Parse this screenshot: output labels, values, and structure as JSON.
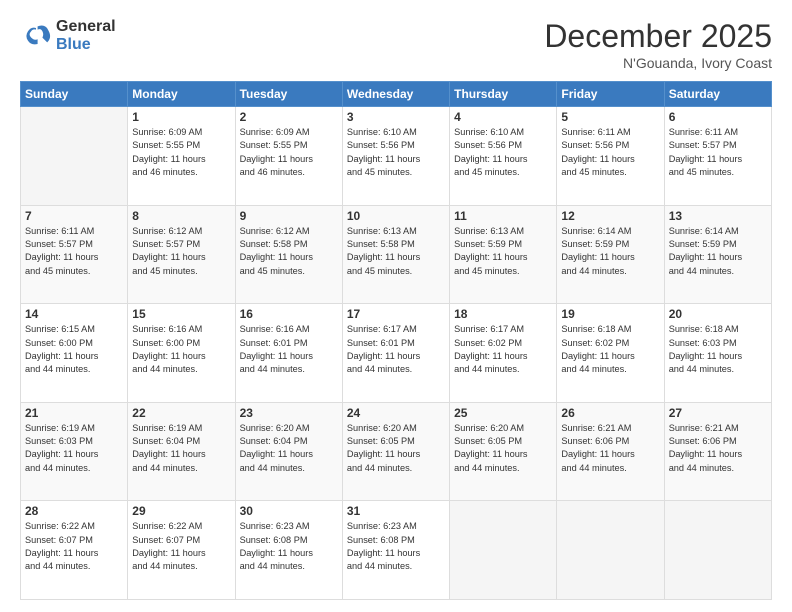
{
  "logo": {
    "general": "General",
    "blue": "Blue"
  },
  "title": "December 2025",
  "location": "N'Gouanda, Ivory Coast",
  "days_header": [
    "Sunday",
    "Monday",
    "Tuesday",
    "Wednesday",
    "Thursday",
    "Friday",
    "Saturday"
  ],
  "weeks": [
    [
      {
        "day": "",
        "info": ""
      },
      {
        "day": "1",
        "info": "Sunrise: 6:09 AM\nSunset: 5:55 PM\nDaylight: 11 hours\nand 46 minutes."
      },
      {
        "day": "2",
        "info": "Sunrise: 6:09 AM\nSunset: 5:55 PM\nDaylight: 11 hours\nand 46 minutes."
      },
      {
        "day": "3",
        "info": "Sunrise: 6:10 AM\nSunset: 5:56 PM\nDaylight: 11 hours\nand 45 minutes."
      },
      {
        "day": "4",
        "info": "Sunrise: 6:10 AM\nSunset: 5:56 PM\nDaylight: 11 hours\nand 45 minutes."
      },
      {
        "day": "5",
        "info": "Sunrise: 6:11 AM\nSunset: 5:56 PM\nDaylight: 11 hours\nand 45 minutes."
      },
      {
        "day": "6",
        "info": "Sunrise: 6:11 AM\nSunset: 5:57 PM\nDaylight: 11 hours\nand 45 minutes."
      }
    ],
    [
      {
        "day": "7",
        "info": "Sunrise: 6:11 AM\nSunset: 5:57 PM\nDaylight: 11 hours\nand 45 minutes."
      },
      {
        "day": "8",
        "info": "Sunrise: 6:12 AM\nSunset: 5:57 PM\nDaylight: 11 hours\nand 45 minutes."
      },
      {
        "day": "9",
        "info": "Sunrise: 6:12 AM\nSunset: 5:58 PM\nDaylight: 11 hours\nand 45 minutes."
      },
      {
        "day": "10",
        "info": "Sunrise: 6:13 AM\nSunset: 5:58 PM\nDaylight: 11 hours\nand 45 minutes."
      },
      {
        "day": "11",
        "info": "Sunrise: 6:13 AM\nSunset: 5:59 PM\nDaylight: 11 hours\nand 45 minutes."
      },
      {
        "day": "12",
        "info": "Sunrise: 6:14 AM\nSunset: 5:59 PM\nDaylight: 11 hours\nand 44 minutes."
      },
      {
        "day": "13",
        "info": "Sunrise: 6:14 AM\nSunset: 5:59 PM\nDaylight: 11 hours\nand 44 minutes."
      }
    ],
    [
      {
        "day": "14",
        "info": "Sunrise: 6:15 AM\nSunset: 6:00 PM\nDaylight: 11 hours\nand 44 minutes."
      },
      {
        "day": "15",
        "info": "Sunrise: 6:16 AM\nSunset: 6:00 PM\nDaylight: 11 hours\nand 44 minutes."
      },
      {
        "day": "16",
        "info": "Sunrise: 6:16 AM\nSunset: 6:01 PM\nDaylight: 11 hours\nand 44 minutes."
      },
      {
        "day": "17",
        "info": "Sunrise: 6:17 AM\nSunset: 6:01 PM\nDaylight: 11 hours\nand 44 minutes."
      },
      {
        "day": "18",
        "info": "Sunrise: 6:17 AM\nSunset: 6:02 PM\nDaylight: 11 hours\nand 44 minutes."
      },
      {
        "day": "19",
        "info": "Sunrise: 6:18 AM\nSunset: 6:02 PM\nDaylight: 11 hours\nand 44 minutes."
      },
      {
        "day": "20",
        "info": "Sunrise: 6:18 AM\nSunset: 6:03 PM\nDaylight: 11 hours\nand 44 minutes."
      }
    ],
    [
      {
        "day": "21",
        "info": "Sunrise: 6:19 AM\nSunset: 6:03 PM\nDaylight: 11 hours\nand 44 minutes."
      },
      {
        "day": "22",
        "info": "Sunrise: 6:19 AM\nSunset: 6:04 PM\nDaylight: 11 hours\nand 44 minutes."
      },
      {
        "day": "23",
        "info": "Sunrise: 6:20 AM\nSunset: 6:04 PM\nDaylight: 11 hours\nand 44 minutes."
      },
      {
        "day": "24",
        "info": "Sunrise: 6:20 AM\nSunset: 6:05 PM\nDaylight: 11 hours\nand 44 minutes."
      },
      {
        "day": "25",
        "info": "Sunrise: 6:20 AM\nSunset: 6:05 PM\nDaylight: 11 hours\nand 44 minutes."
      },
      {
        "day": "26",
        "info": "Sunrise: 6:21 AM\nSunset: 6:06 PM\nDaylight: 11 hours\nand 44 minutes."
      },
      {
        "day": "27",
        "info": "Sunrise: 6:21 AM\nSunset: 6:06 PM\nDaylight: 11 hours\nand 44 minutes."
      }
    ],
    [
      {
        "day": "28",
        "info": "Sunrise: 6:22 AM\nSunset: 6:07 PM\nDaylight: 11 hours\nand 44 minutes."
      },
      {
        "day": "29",
        "info": "Sunrise: 6:22 AM\nSunset: 6:07 PM\nDaylight: 11 hours\nand 44 minutes."
      },
      {
        "day": "30",
        "info": "Sunrise: 6:23 AM\nSunset: 6:08 PM\nDaylight: 11 hours\nand 44 minutes."
      },
      {
        "day": "31",
        "info": "Sunrise: 6:23 AM\nSunset: 6:08 PM\nDaylight: 11 hours\nand 44 minutes."
      },
      {
        "day": "",
        "info": ""
      },
      {
        "day": "",
        "info": ""
      },
      {
        "day": "",
        "info": ""
      }
    ]
  ]
}
